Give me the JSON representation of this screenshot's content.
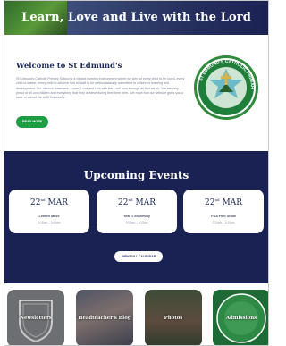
{
  "hero": {
    "title": "Learn, Love and Live with the Lord"
  },
  "welcome": {
    "heading": "Welcome to St Edmund's",
    "paragraph": "St Edmund's Catholic Primary School is a vibrant learning environment where we aim for every child to be loved, every child to matter, every child to achieve and all staff to be enthusiastically committed to children's learning and development. Our mission statement, 'Learn, Love and Live with the Lord' runs through all that we do. We are very proud of all our children and everything that they achieve during their time here. We hope that our website gives you a taste of school life at St Edmund's.",
    "read_more_label": "READ MORE",
    "crest_text": "ST EDMUND'S CATHOLIC PRIMARY"
  },
  "events": {
    "heading": "Upcoming Events",
    "items": [
      {
        "day": "22",
        "suffix": "nd",
        "month": "MAR",
        "title": "Lenten Mass",
        "time": "9:15am – 9:45am"
      },
      {
        "day": "22",
        "suffix": "nd",
        "month": "MAR",
        "title": "Year 1 Assembly",
        "time": "9:00am – 9:15am"
      },
      {
        "day": "22",
        "suffix": "nd",
        "month": "MAR",
        "title": "PSA Film Show",
        "time": "3:30pm – 5:15pm"
      }
    ],
    "calendar_label": "VIEW FULL CALENDAR"
  },
  "tiles": [
    {
      "label": "Newsletters"
    },
    {
      "label": "Headteacher's Blog"
    },
    {
      "label": "Photos"
    },
    {
      "label": "Admissions"
    }
  ],
  "colors": {
    "navy": "#1a2254",
    "green": "#1f9d45",
    "heading_text": "#1c2a5c"
  }
}
